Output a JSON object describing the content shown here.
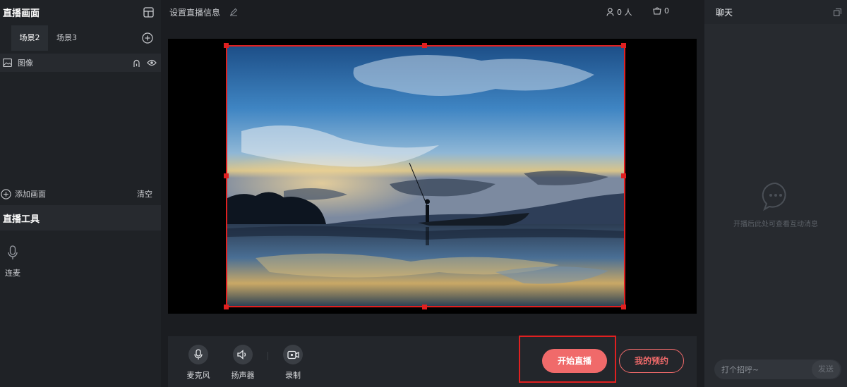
{
  "left": {
    "live_screen_title": "直播画面",
    "scenes": [
      {
        "label": "场景2",
        "active": true
      },
      {
        "label": "场景3",
        "active": false
      }
    ],
    "source_label": "图像",
    "add_screen_label": "添加画面",
    "clear_label": "清空",
    "tools_title": "直播工具",
    "tools": [
      {
        "label": "连麦",
        "icon": "mic-icon"
      }
    ]
  },
  "top": {
    "live_info_label": "设置直播信息",
    "viewers": "0 人",
    "carts": "0"
  },
  "bottom": {
    "tools": [
      {
        "label": "麦克风",
        "icon": "mic-icon"
      },
      {
        "label": "扬声器",
        "icon": "speaker-icon"
      },
      {
        "label": "录制",
        "icon": "record-icon"
      }
    ],
    "start_label": "开始直播",
    "reserve_label": "我的预约"
  },
  "chat": {
    "title": "聊天",
    "empty_hint": "开播后此处可查看互动消息",
    "input_placeholder": "打个招呼~",
    "send_label": "发送"
  },
  "colors": {
    "accent": "#f06a6a",
    "selection": "#e02020",
    "panel": "#1f2226",
    "background": "#1b1d21"
  }
}
